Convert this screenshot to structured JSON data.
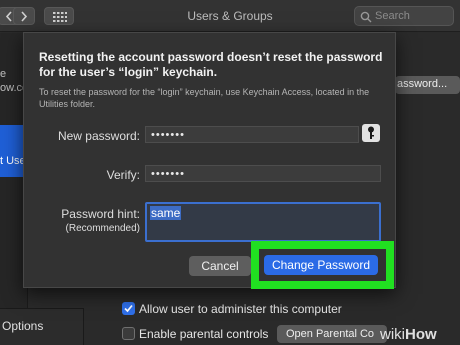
{
  "window": {
    "title": "Users & Groups"
  },
  "search": {
    "placeholder": "Search",
    "icon": "search-icon"
  },
  "sidebar": {
    "fragments": [
      "e",
      "ow.co",
      "t Use"
    ],
    "options_label": "Options"
  },
  "main": {
    "password_button_label": "assword...",
    "admin_checkbox": {
      "label": "Allow user to administer this computer",
      "checked": true
    },
    "parental_checkbox": {
      "label": "Enable parental controls",
      "checked": false
    },
    "open_parental_label": "Open Parental Co"
  },
  "sheet": {
    "title": "Resetting the account password doesn’t reset the password for the user’s “login” keychain.",
    "subtitle": "To reset the password for the “login” keychain, use Keychain Access, located in the Utilities folder.",
    "new_password_label": "New password:",
    "new_password_value": "•••••••",
    "verify_label": "Verify:",
    "verify_value": "•••••••",
    "hint_label": "Password hint:",
    "hint_sublabel": "(Recommended)",
    "hint_value": "same",
    "cancel_label": "Cancel",
    "change_label": "Change Password",
    "highlight_color": "#21e021"
  },
  "watermark": {
    "prefix": "wiki",
    "suffix": "How"
  }
}
